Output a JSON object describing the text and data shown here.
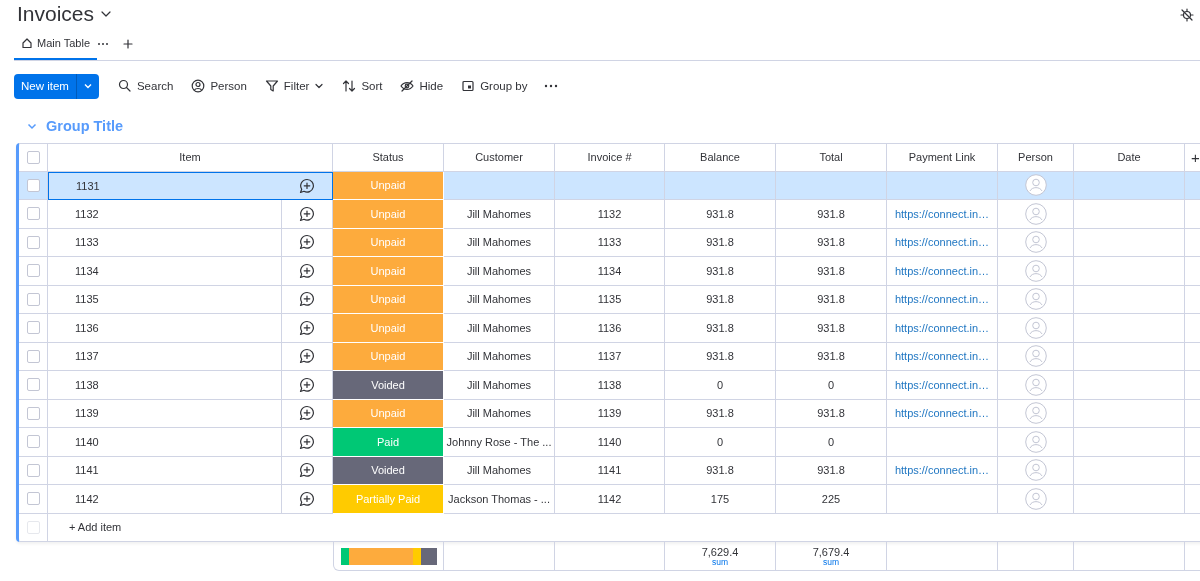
{
  "board": {
    "title": "Invoices"
  },
  "views": [
    {
      "label": "Main Table",
      "selected": true
    }
  ],
  "toolbar": {
    "primary": "New item",
    "tools": [
      {
        "kind": "search",
        "label": "Search"
      },
      {
        "kind": "person",
        "label": "Person"
      },
      {
        "kind": "filter",
        "label": "Filter"
      },
      {
        "kind": "sort",
        "label": "Sort"
      },
      {
        "kind": "hide",
        "label": "Hide"
      },
      {
        "kind": "group",
        "label": "Group by"
      }
    ]
  },
  "group": {
    "title": "Group Title",
    "expanded": true
  },
  "table": {
    "all_checked": false,
    "columns": [
      "Item",
      "Status",
      "Customer",
      "Invoice #",
      "Balance",
      "Total",
      "Payment Link",
      "Person",
      "Date",
      "+"
    ],
    "rows": [
      {
        "item": "1131",
        "selected": true,
        "checked": false,
        "status": {
          "kind": "unpaid",
          "label": "Unpaid",
          "color": "#fdab3d"
        }
      },
      {
        "item": "1132",
        "selected": false,
        "checked": false,
        "status": {
          "kind": "unpaid",
          "label": "Unpaid",
          "color": "#fdab3d"
        },
        "customer": "Jill Mahomes",
        "invoice": "1132",
        "balance": "931.8",
        "total": "931.8",
        "link": "https://connect.in…"
      },
      {
        "item": "1133",
        "selected": false,
        "checked": false,
        "status": {
          "kind": "unpaid",
          "label": "Unpaid",
          "color": "#fdab3d"
        },
        "customer": "Jill Mahomes",
        "invoice": "1133",
        "balance": "931.8",
        "total": "931.8",
        "link": "https://connect.in…"
      },
      {
        "item": "1134",
        "selected": false,
        "checked": false,
        "status": {
          "kind": "unpaid",
          "label": "Unpaid",
          "color": "#fdab3d"
        },
        "customer": "Jill Mahomes",
        "invoice": "1134",
        "balance": "931.8",
        "total": "931.8",
        "link": "https://connect.in…"
      },
      {
        "item": "1135",
        "selected": false,
        "checked": false,
        "status": {
          "kind": "unpaid",
          "label": "Unpaid",
          "color": "#fdab3d"
        },
        "customer": "Jill Mahomes",
        "invoice": "1135",
        "balance": "931.8",
        "total": "931.8",
        "link": "https://connect.in…"
      },
      {
        "item": "1136",
        "selected": false,
        "checked": false,
        "status": {
          "kind": "unpaid",
          "label": "Unpaid",
          "color": "#fdab3d"
        },
        "customer": "Jill Mahomes",
        "invoice": "1136",
        "balance": "931.8",
        "total": "931.8",
        "link": "https://connect.in…"
      },
      {
        "item": "1137",
        "selected": false,
        "checked": false,
        "status": {
          "kind": "unpaid",
          "label": "Unpaid",
          "color": "#fdab3d"
        },
        "customer": "Jill Mahomes",
        "invoice": "1137",
        "balance": "931.8",
        "total": "931.8",
        "link": "https://connect.in…"
      },
      {
        "item": "1138",
        "selected": false,
        "checked": false,
        "status": {
          "kind": "voided",
          "label": "Voided",
          "color": "#676879"
        },
        "customer": "Jill Mahomes",
        "invoice": "1138",
        "balance": "0",
        "total": "0",
        "link": "https://connect.in…"
      },
      {
        "item": "1139",
        "selected": false,
        "checked": false,
        "status": {
          "kind": "unpaid",
          "label": "Unpaid",
          "color": "#fdab3d"
        },
        "customer": "Jill Mahomes",
        "invoice": "1139",
        "balance": "931.8",
        "total": "931.8",
        "link": "https://connect.in…"
      },
      {
        "item": "1140",
        "selected": false,
        "checked": false,
        "status": {
          "kind": "paid",
          "label": "Paid",
          "color": "#00c875"
        },
        "customer": "Johnny Rose - The ...",
        "invoice": "1140",
        "balance": "0",
        "total": "0"
      },
      {
        "item": "1141",
        "selected": false,
        "checked": false,
        "status": {
          "kind": "voided",
          "label": "Voided",
          "color": "#676879"
        },
        "customer": "Jill Mahomes",
        "invoice": "1141",
        "balance": "931.8",
        "total": "931.8",
        "link": "https://connect.in…"
      },
      {
        "item": "1142",
        "selected": false,
        "checked": false,
        "status": {
          "kind": "partial",
          "label": "Partially Paid",
          "color": "#ffcb00"
        },
        "customer": "Jackson Thomas - ...",
        "invoice": "1142",
        "balance": "175",
        "total": "225"
      }
    ],
    "add_item": {
      "label": "+ Add item",
      "checked": false
    },
    "summary": {
      "balance": "7,629.4",
      "balance_fn": "sum",
      "total": "7,679.4",
      "total_fn": "sum"
    }
  }
}
